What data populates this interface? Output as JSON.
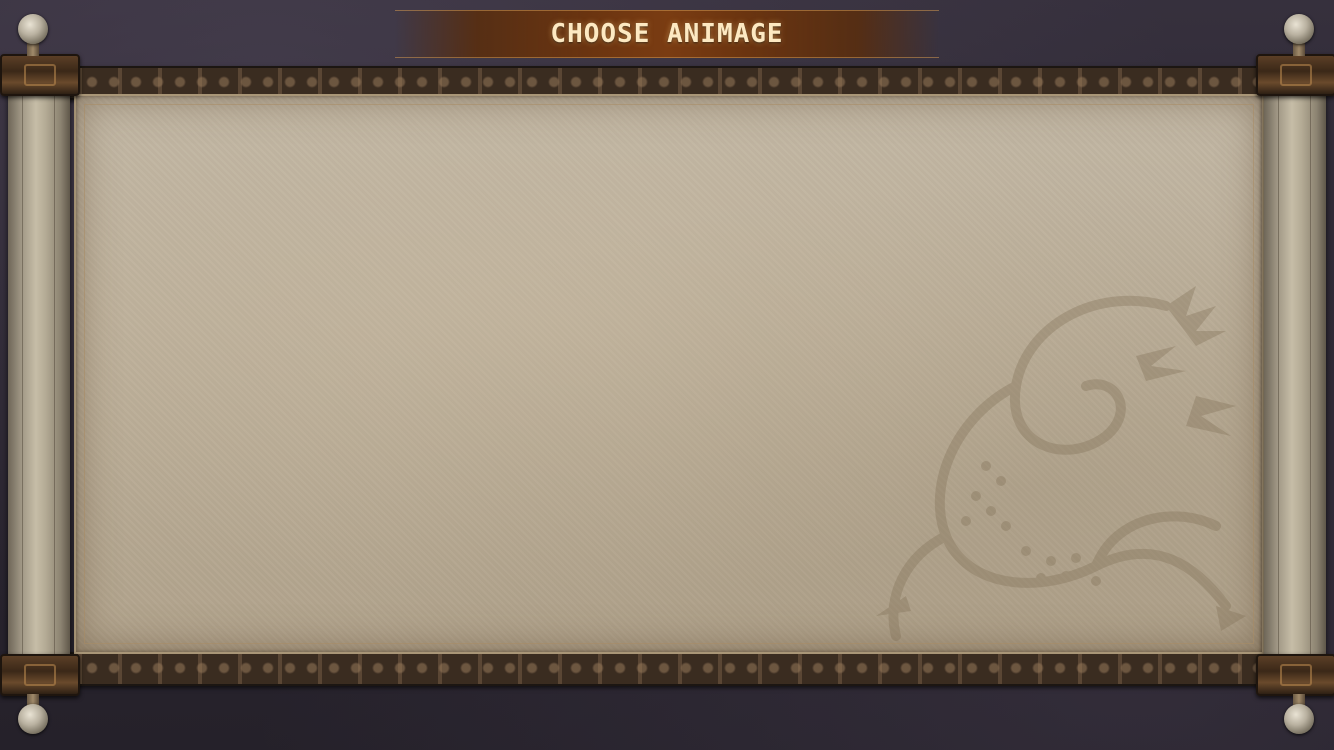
{
  "screen": {
    "title": "CHOOSE ANIMAGE"
  },
  "theme": {
    "title_color": "#fde9c2",
    "banner_color": "#7a3c12",
    "parchment_color": "#bdb09b",
    "trim_color": "#3a2c20"
  },
  "decoration": {
    "watermark_icon": "dragon-icon"
  }
}
